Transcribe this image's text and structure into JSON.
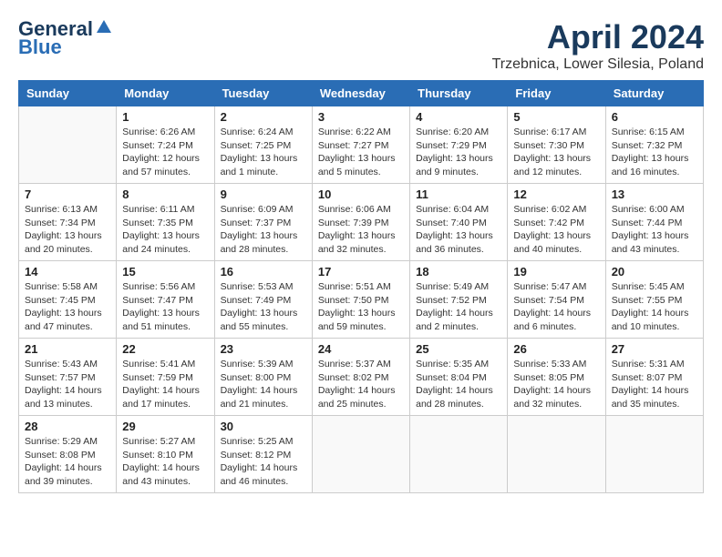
{
  "header": {
    "logo_line1": "General",
    "logo_line2": "Blue",
    "month_title": "April 2024",
    "location": "Trzebnica, Lower Silesia, Poland"
  },
  "weekdays": [
    "Sunday",
    "Monday",
    "Tuesday",
    "Wednesday",
    "Thursday",
    "Friday",
    "Saturday"
  ],
  "weeks": [
    [
      {
        "day": "",
        "sunrise": "",
        "sunset": "",
        "daylight": ""
      },
      {
        "day": "1",
        "sunrise": "Sunrise: 6:26 AM",
        "sunset": "Sunset: 7:24 PM",
        "daylight": "Daylight: 12 hours and 57 minutes."
      },
      {
        "day": "2",
        "sunrise": "Sunrise: 6:24 AM",
        "sunset": "Sunset: 7:25 PM",
        "daylight": "Daylight: 13 hours and 1 minute."
      },
      {
        "day": "3",
        "sunrise": "Sunrise: 6:22 AM",
        "sunset": "Sunset: 7:27 PM",
        "daylight": "Daylight: 13 hours and 5 minutes."
      },
      {
        "day": "4",
        "sunrise": "Sunrise: 6:20 AM",
        "sunset": "Sunset: 7:29 PM",
        "daylight": "Daylight: 13 hours and 9 minutes."
      },
      {
        "day": "5",
        "sunrise": "Sunrise: 6:17 AM",
        "sunset": "Sunset: 7:30 PM",
        "daylight": "Daylight: 13 hours and 12 minutes."
      },
      {
        "day": "6",
        "sunrise": "Sunrise: 6:15 AM",
        "sunset": "Sunset: 7:32 PM",
        "daylight": "Daylight: 13 hours and 16 minutes."
      }
    ],
    [
      {
        "day": "7",
        "sunrise": "Sunrise: 6:13 AM",
        "sunset": "Sunset: 7:34 PM",
        "daylight": "Daylight: 13 hours and 20 minutes."
      },
      {
        "day": "8",
        "sunrise": "Sunrise: 6:11 AM",
        "sunset": "Sunset: 7:35 PM",
        "daylight": "Daylight: 13 hours and 24 minutes."
      },
      {
        "day": "9",
        "sunrise": "Sunrise: 6:09 AM",
        "sunset": "Sunset: 7:37 PM",
        "daylight": "Daylight: 13 hours and 28 minutes."
      },
      {
        "day": "10",
        "sunrise": "Sunrise: 6:06 AM",
        "sunset": "Sunset: 7:39 PM",
        "daylight": "Daylight: 13 hours and 32 minutes."
      },
      {
        "day": "11",
        "sunrise": "Sunrise: 6:04 AM",
        "sunset": "Sunset: 7:40 PM",
        "daylight": "Daylight: 13 hours and 36 minutes."
      },
      {
        "day": "12",
        "sunrise": "Sunrise: 6:02 AM",
        "sunset": "Sunset: 7:42 PM",
        "daylight": "Daylight: 13 hours and 40 minutes."
      },
      {
        "day": "13",
        "sunrise": "Sunrise: 6:00 AM",
        "sunset": "Sunset: 7:44 PM",
        "daylight": "Daylight: 13 hours and 43 minutes."
      }
    ],
    [
      {
        "day": "14",
        "sunrise": "Sunrise: 5:58 AM",
        "sunset": "Sunset: 7:45 PM",
        "daylight": "Daylight: 13 hours and 47 minutes."
      },
      {
        "day": "15",
        "sunrise": "Sunrise: 5:56 AM",
        "sunset": "Sunset: 7:47 PM",
        "daylight": "Daylight: 13 hours and 51 minutes."
      },
      {
        "day": "16",
        "sunrise": "Sunrise: 5:53 AM",
        "sunset": "Sunset: 7:49 PM",
        "daylight": "Daylight: 13 hours and 55 minutes."
      },
      {
        "day": "17",
        "sunrise": "Sunrise: 5:51 AM",
        "sunset": "Sunset: 7:50 PM",
        "daylight": "Daylight: 13 hours and 59 minutes."
      },
      {
        "day": "18",
        "sunrise": "Sunrise: 5:49 AM",
        "sunset": "Sunset: 7:52 PM",
        "daylight": "Daylight: 14 hours and 2 minutes."
      },
      {
        "day": "19",
        "sunrise": "Sunrise: 5:47 AM",
        "sunset": "Sunset: 7:54 PM",
        "daylight": "Daylight: 14 hours and 6 minutes."
      },
      {
        "day": "20",
        "sunrise": "Sunrise: 5:45 AM",
        "sunset": "Sunset: 7:55 PM",
        "daylight": "Daylight: 14 hours and 10 minutes."
      }
    ],
    [
      {
        "day": "21",
        "sunrise": "Sunrise: 5:43 AM",
        "sunset": "Sunset: 7:57 PM",
        "daylight": "Daylight: 14 hours and 13 minutes."
      },
      {
        "day": "22",
        "sunrise": "Sunrise: 5:41 AM",
        "sunset": "Sunset: 7:59 PM",
        "daylight": "Daylight: 14 hours and 17 minutes."
      },
      {
        "day": "23",
        "sunrise": "Sunrise: 5:39 AM",
        "sunset": "Sunset: 8:00 PM",
        "daylight": "Daylight: 14 hours and 21 minutes."
      },
      {
        "day": "24",
        "sunrise": "Sunrise: 5:37 AM",
        "sunset": "Sunset: 8:02 PM",
        "daylight": "Daylight: 14 hours and 25 minutes."
      },
      {
        "day": "25",
        "sunrise": "Sunrise: 5:35 AM",
        "sunset": "Sunset: 8:04 PM",
        "daylight": "Daylight: 14 hours and 28 minutes."
      },
      {
        "day": "26",
        "sunrise": "Sunrise: 5:33 AM",
        "sunset": "Sunset: 8:05 PM",
        "daylight": "Daylight: 14 hours and 32 minutes."
      },
      {
        "day": "27",
        "sunrise": "Sunrise: 5:31 AM",
        "sunset": "Sunset: 8:07 PM",
        "daylight": "Daylight: 14 hours and 35 minutes."
      }
    ],
    [
      {
        "day": "28",
        "sunrise": "Sunrise: 5:29 AM",
        "sunset": "Sunset: 8:08 PM",
        "daylight": "Daylight: 14 hours and 39 minutes."
      },
      {
        "day": "29",
        "sunrise": "Sunrise: 5:27 AM",
        "sunset": "Sunset: 8:10 PM",
        "daylight": "Daylight: 14 hours and 43 minutes."
      },
      {
        "day": "30",
        "sunrise": "Sunrise: 5:25 AM",
        "sunset": "Sunset: 8:12 PM",
        "daylight": "Daylight: 14 hours and 46 minutes."
      },
      {
        "day": "",
        "sunrise": "",
        "sunset": "",
        "daylight": ""
      },
      {
        "day": "",
        "sunrise": "",
        "sunset": "",
        "daylight": ""
      },
      {
        "day": "",
        "sunrise": "",
        "sunset": "",
        "daylight": ""
      },
      {
        "day": "",
        "sunrise": "",
        "sunset": "",
        "daylight": ""
      }
    ]
  ]
}
